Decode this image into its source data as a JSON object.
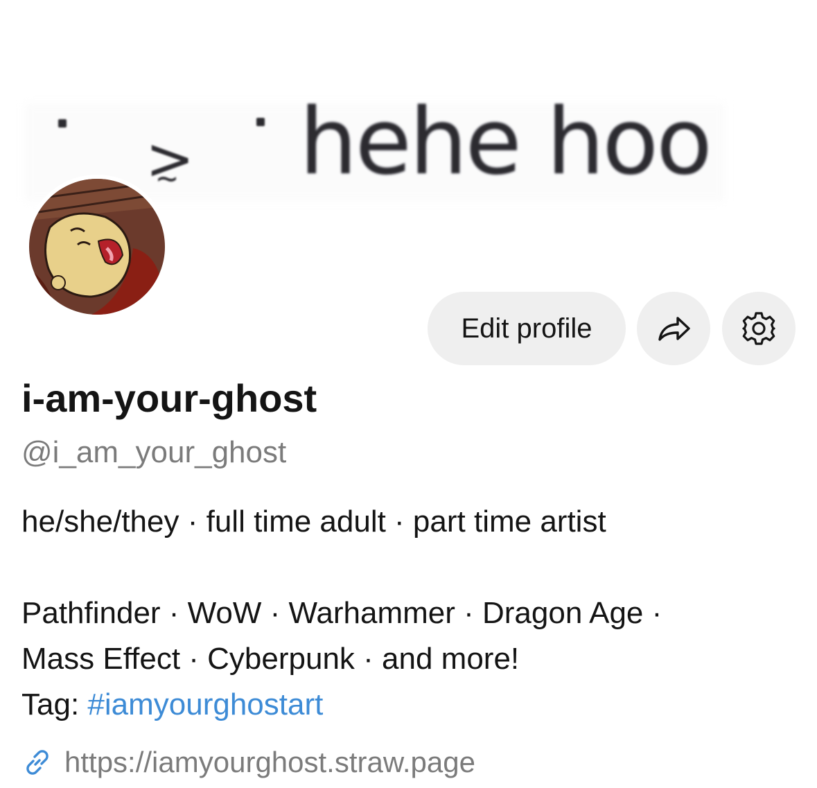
{
  "banner": {
    "text": "hehe hoo",
    "emote_mouth": ">",
    "emote_sub": "~"
  },
  "profile": {
    "display_name": "i-am-your-ghost",
    "handle": "@i_am_your_ghost",
    "bio": {
      "line1": "he/she/they · full time adult · part time artist",
      "line2": "Pathfinder · WoW · Warhammer · Dragon Age ·",
      "line3": "Mass Effect · Cyberpunk · and more!",
      "tag_label": "Tag: ",
      "tag_value": "#iamyourghostart"
    },
    "link": "https://iamyourghost.straw.page"
  },
  "actions": {
    "edit_label": "Edit profile",
    "share_icon": "share-arrow-icon",
    "settings_icon": "gear-icon"
  },
  "colors": {
    "button_bg": "#efefef",
    "hashtag": "#3d8bd6",
    "muted_text": "#7b7b7b"
  }
}
